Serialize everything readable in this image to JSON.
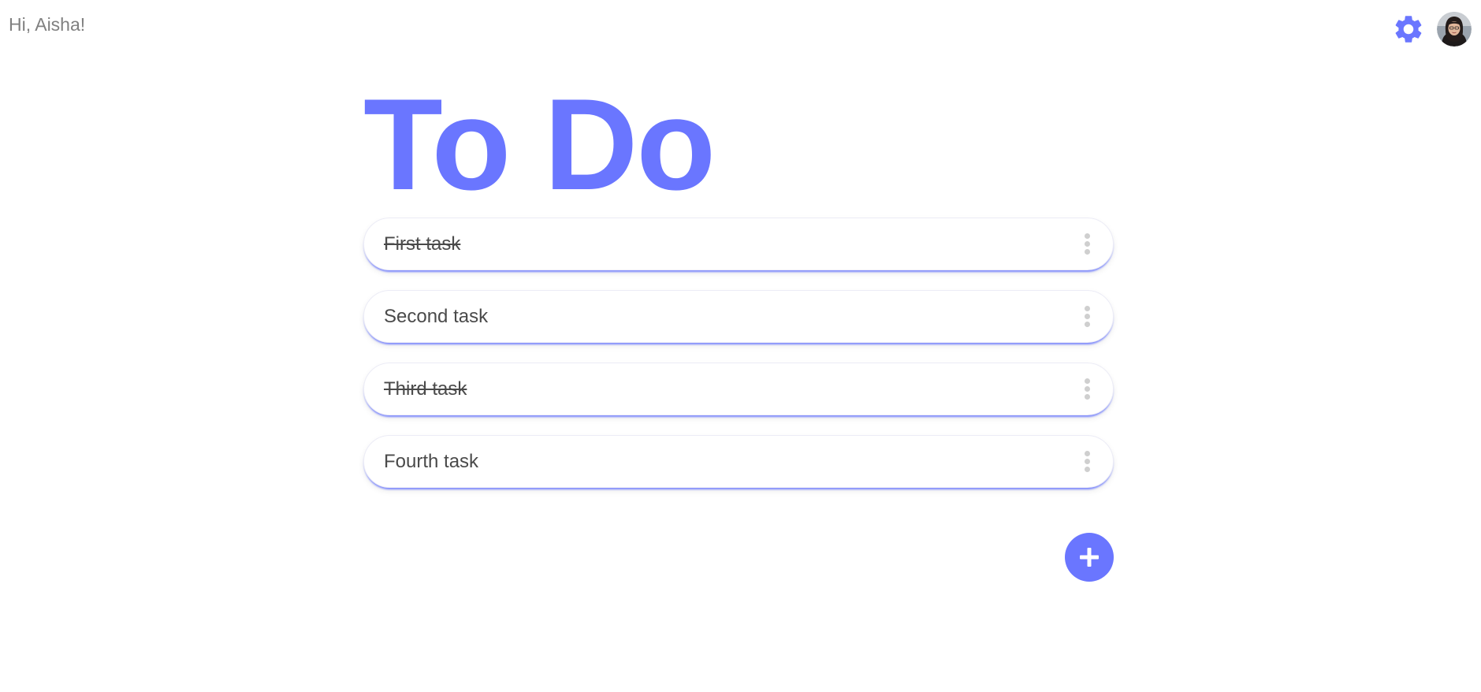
{
  "header": {
    "greeting": "Hi, Aisha!",
    "settings_icon": "gear-icon",
    "avatar_icon": "user-avatar"
  },
  "main": {
    "title": "To Do",
    "tasks": [
      {
        "label": "First task",
        "completed": true
      },
      {
        "label": "Second task",
        "completed": false
      },
      {
        "label": "Third task",
        "completed": true
      },
      {
        "label": "Fourth task",
        "completed": false
      }
    ],
    "task_menu_icon": "more-vertical-icon",
    "add_icon": "plus-icon"
  },
  "colors": {
    "accent": "#6A76FF",
    "text": "#4A4A4A",
    "greeting": "#808080",
    "menu_dots": "#CFCFCF",
    "background": "#FFFFFF"
  }
}
